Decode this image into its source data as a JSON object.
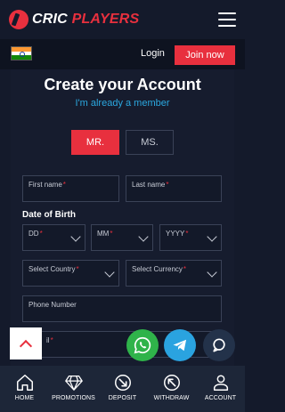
{
  "header": {
    "logo_part1": "CRIC",
    "logo_part2": "PLAYERS",
    "login": "Login",
    "join": "Join now"
  },
  "form": {
    "title": "Create your Account",
    "member_link": "I'm already a member",
    "title_mr": "MR.",
    "title_ms": "MS.",
    "first_name": "First name",
    "last_name": "Last name",
    "dob_label": "Date of Birth",
    "dd": "DD",
    "mm": "MM",
    "yyyy": "YYYY",
    "country": "Select Country",
    "currency": "Select Currency",
    "phone": "Phone Number",
    "email_partial": "il"
  },
  "nav": {
    "home": "HOME",
    "promotions": "PROMOTIONS",
    "deposit": "DEPOSIT",
    "withdraw": "WITHDRAW",
    "account": "ACCOUNT"
  },
  "colors": {
    "accent": "#e8303e",
    "link": "#2ba8e0",
    "background": "#141a2b"
  }
}
